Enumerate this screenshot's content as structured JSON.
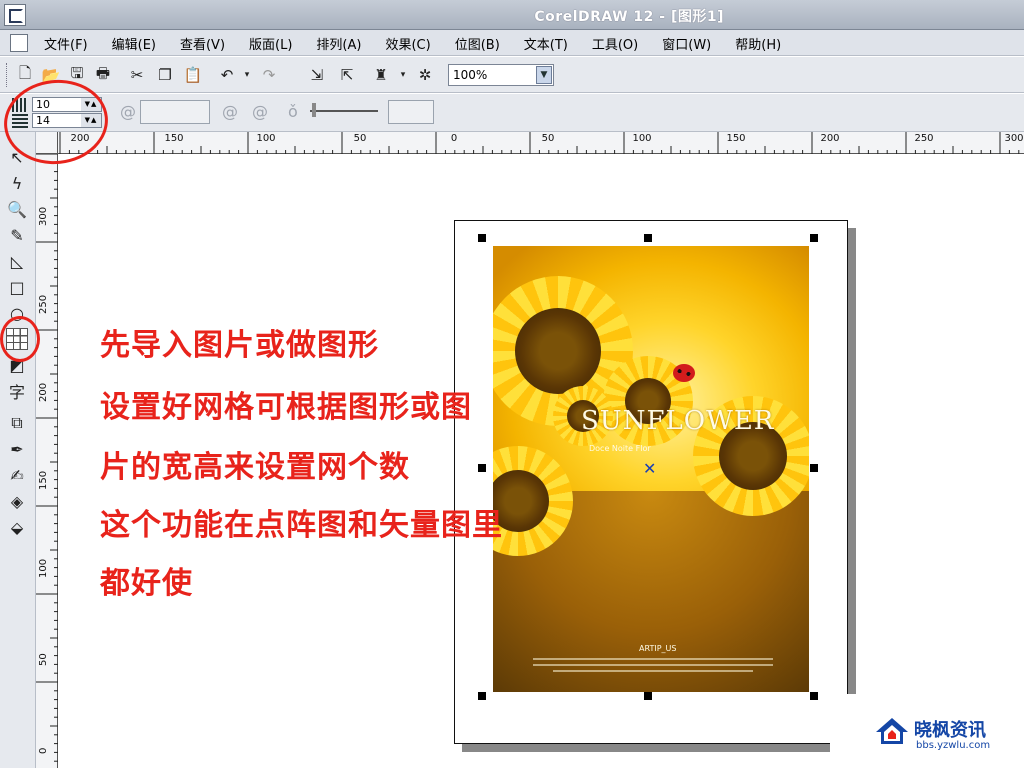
{
  "window": {
    "title": "CorelDRAW 12 - [图形1]"
  },
  "menu": [
    "文件(F)",
    "编辑(E)",
    "查看(V)",
    "版面(L)",
    "排列(A)",
    "效果(C)",
    "位图(B)",
    "文本(T)",
    "工具(O)",
    "窗口(W)",
    "帮助(H)"
  ],
  "toolbar": {
    "zoom_value": "100%"
  },
  "property_bar": {
    "columns": "10",
    "rows": "14"
  },
  "ruler": {
    "horizontal": [
      "200",
      "150",
      "100",
      "50",
      "0",
      "50",
      "100",
      "150",
      "200",
      "250",
      "300"
    ],
    "vertical": [
      "300",
      "250",
      "200",
      "150",
      "100",
      "50",
      "0"
    ]
  },
  "image": {
    "title": "SUNFLOWER",
    "subtitle": "Doce Noite Flor",
    "footer_title": "ARTIP_US"
  },
  "annotation": [
    "先导入图片或做图形",
    "设置好网格可根据图形或图",
    "片的宽高来设置网个数",
    "这个功能在点阵图和矢量图里",
    "都好使"
  ],
  "watermark": {
    "name": "晓枫资讯",
    "url": "bbs.yzwlu.com"
  },
  "colors": {
    "annotation": "#e8231b",
    "watermark": "#1446a6",
    "selection_center": "#1a3fb5"
  }
}
